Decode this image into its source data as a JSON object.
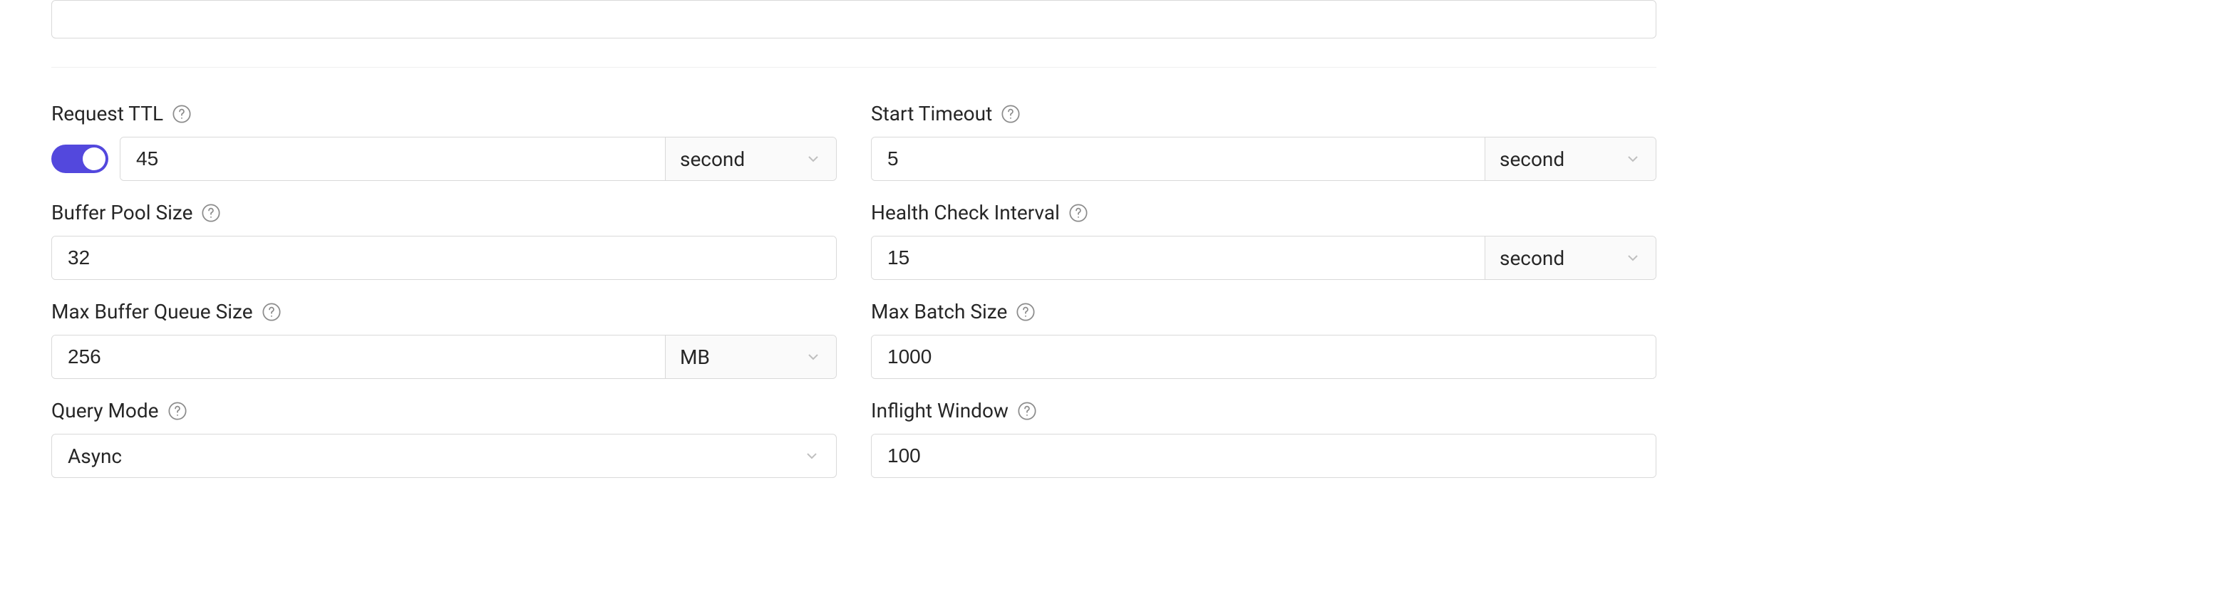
{
  "form": {
    "requestTtl": {
      "label": "Request TTL",
      "value": "45",
      "unit": "second",
      "enabled": true
    },
    "startTimeout": {
      "label": "Start Timeout",
      "value": "5",
      "unit": "second"
    },
    "bufferPoolSize": {
      "label": "Buffer Pool Size",
      "value": "32"
    },
    "healthCheckInterval": {
      "label": "Health Check Interval",
      "value": "15",
      "unit": "second"
    },
    "maxBufferQueueSize": {
      "label": "Max Buffer Queue Size",
      "value": "256",
      "unit": "MB"
    },
    "maxBatchSize": {
      "label": "Max Batch Size",
      "value": "1000"
    },
    "queryMode": {
      "label": "Query Mode",
      "value": "Async"
    },
    "inflightWindow": {
      "label": "Inflight Window",
      "value": "100"
    }
  }
}
